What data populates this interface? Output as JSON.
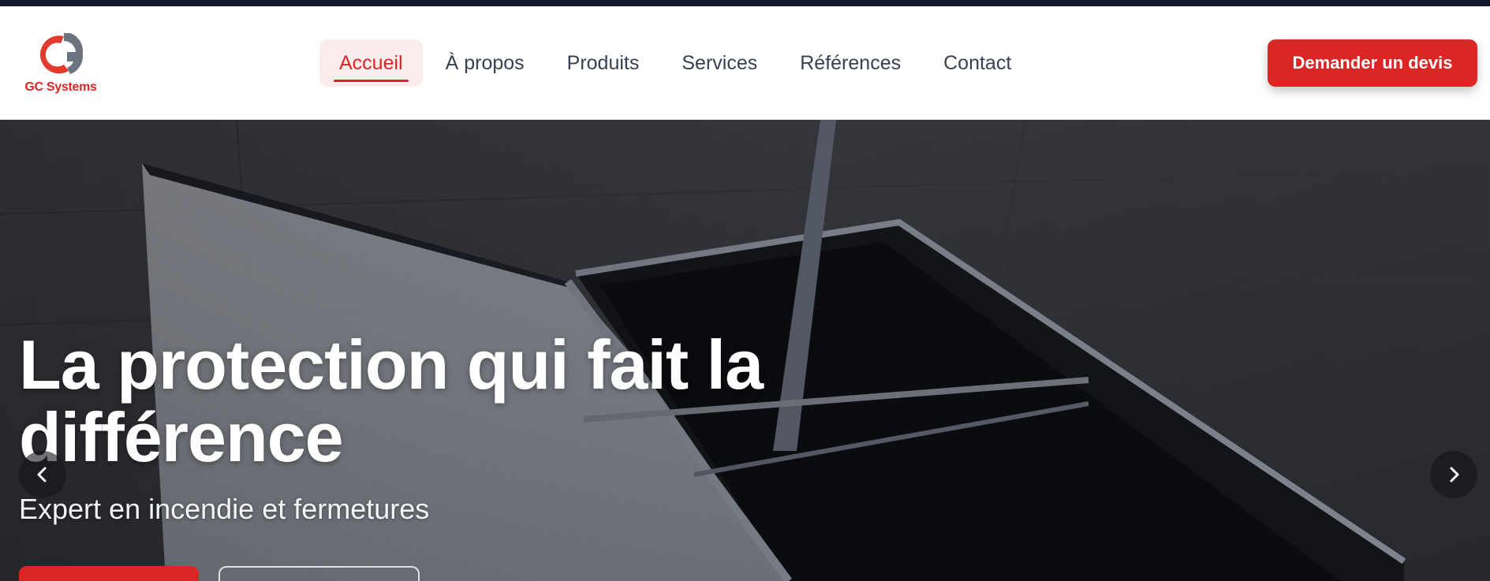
{
  "logo": {
    "text_gc": "GC",
    "text_systems": "Systems"
  },
  "nav": {
    "items": [
      {
        "label": "Accueil",
        "active": true
      },
      {
        "label": "À propos",
        "active": false
      },
      {
        "label": "Produits",
        "active": false
      },
      {
        "label": "Services",
        "active": false
      },
      {
        "label": "Références",
        "active": false
      },
      {
        "label": "Contact",
        "active": false
      }
    ],
    "cta_label": "Demander un devis"
  },
  "hero": {
    "title_line1": "La protection qui fait la",
    "title_line2": "différence",
    "subtitle": "Expert en incendie et fermetures"
  },
  "icons": {
    "logo": "gc-systems-logo",
    "prev": "chevron-left-icon",
    "next": "chevron-right-icon"
  },
  "colors": {
    "accent": "#dc2626",
    "text": "#374151",
    "topbar": "#111827"
  }
}
